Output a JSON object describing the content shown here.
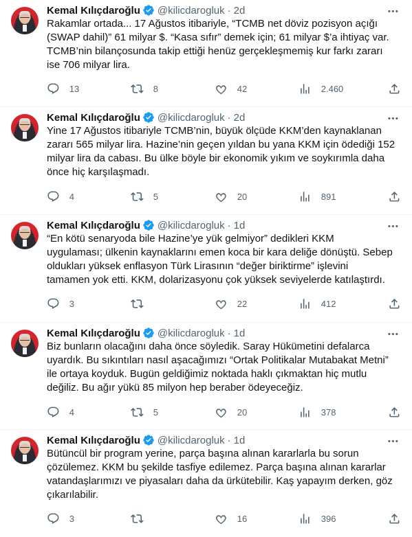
{
  "tweets": [
    {
      "name": "Kemal Kılıçdaroğlu",
      "handle": "@kilicdarogluk",
      "time": "2d",
      "lines": [
        "Rakamlar ortada... 17 Ağustos itibariyle, “TCMB net döviz pozisyon açığı",
        "(SWAP dahil)” 61 milyar $. “Kasa sıfır” demek için; 61 milyar $’a ihtiyaç var.",
        "TCMB’nin bilançosunda takip ettiği henüz gerçekleşmemiş kur farkı zararı",
        "ise 706 milyar lira."
      ],
      "replies": "13",
      "retweets": "8",
      "likes": "42",
      "views": "2.460"
    },
    {
      "name": "Kemal Kılıçdaroğlu",
      "handle": "@kilicdarogluk",
      "time": "2d",
      "lines": [
        "Yine 17 Ağustos itibariyle TCMB’nin, büyük ölçüde KKM’den kaynaklanan",
        "zararı 565 milyar lira. Hazine’nin geçen yıldan bu yana KKM için ödediği 152",
        "milyar lira da cabası. Bu ülke böyle bir ekonomik yıkım ve soykırımla daha",
        "önce hiç karşılaşmadı."
      ],
      "replies": "4",
      "retweets": "5",
      "likes": "20",
      "views": "891"
    },
    {
      "name": "Kemal Kılıçdaroğlu",
      "handle": "@kilicdarogluk",
      "time": "1d",
      "lines": [
        "“En kötü senaryoda bile Hazine’ye yük gelmiyor” dedikleri KKM",
        "uygulaması; ülkenin kaynaklarını emen koca bir kara deliğe dönüştü. Sebep",
        "oldukları yüksek enflasyon Türk Lirasının “değer biriktirme” işlevini",
        "tamamen yok etti. KKM, dolarizasyonu çok yüksek seviyelerde katılaştırdı."
      ],
      "replies": "3",
      "retweets": "",
      "likes": "22",
      "views": "412"
    },
    {
      "name": "Kemal Kılıçdaroğlu",
      "handle": "@kilicdarogluk",
      "time": "1d",
      "lines": [
        "Biz bunların olacağını daha önce söyledik. Saray Hükümetini defalarca",
        "uyardık. Bu sıkıntıları nasıl aşacağımızı “Ortak Politikalar Mutabakat Metni”",
        "ile ortaya koyduk. Bugün geldiğimiz noktada haklı çıkmaktan hiç mutlu",
        "değiliz. Bu ağır yükü 85 milyon hep beraber ödeyeceğiz."
      ],
      "replies": "4",
      "retweets": "5",
      "likes": "20",
      "views": "378"
    },
    {
      "name": "Kemal Kılıçdaroğlu",
      "handle": "@kilicdarogluk",
      "time": "1d",
      "lines": [
        "Bütüncül bir program yerine, parça başına alınan kararlarla bu sorun",
        "çözülemez. KKM bu şekilde tasfiye edilemez. Parça başına alınan kararlar",
        "vatandaşlarımızı ve piyasaları daha da ürkütebilir. Kaş yapayım derken, göz",
        "çıkarılabilir."
      ],
      "replies": "3",
      "retweets": "",
      "likes": "16",
      "views": "396"
    }
  ]
}
